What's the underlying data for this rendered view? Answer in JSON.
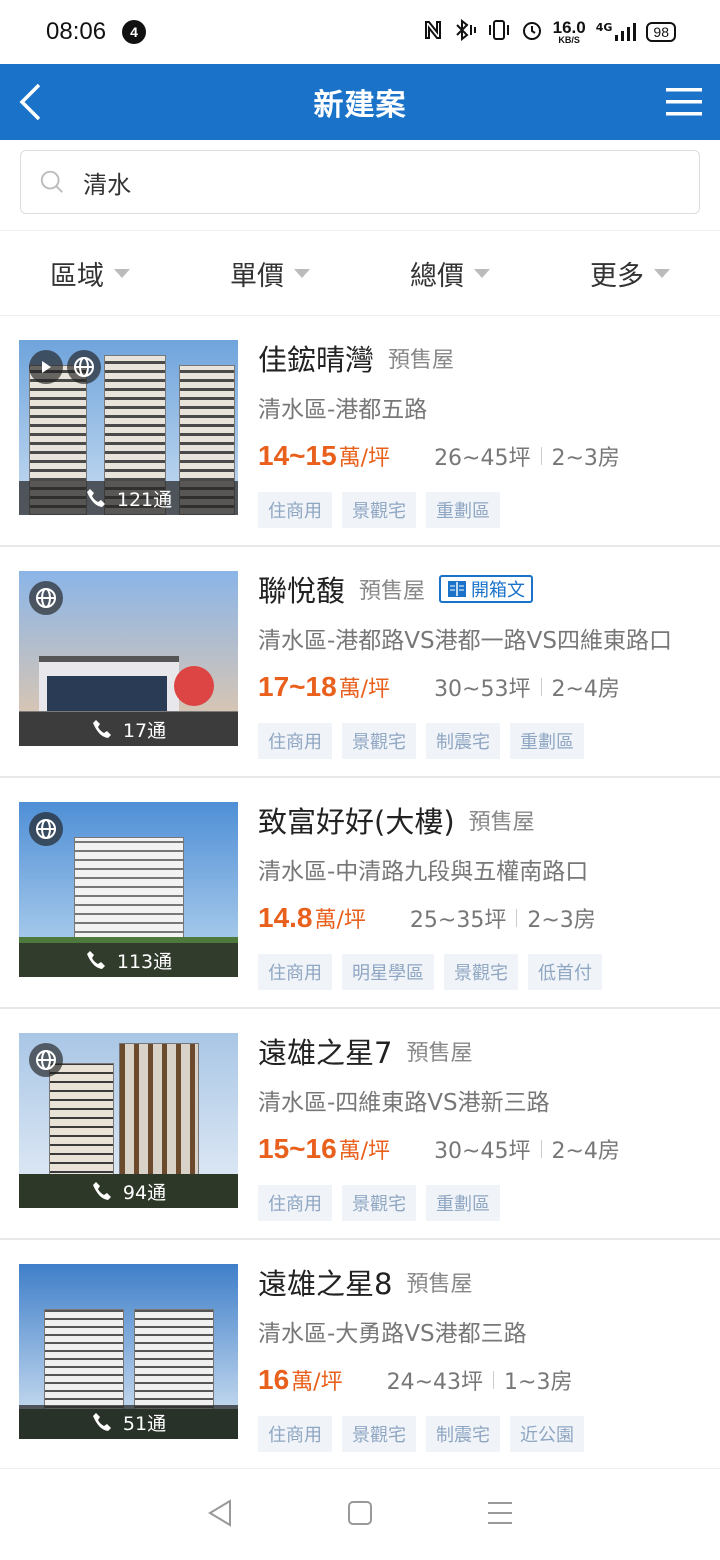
{
  "status": {
    "time": "08:06",
    "notif_count": "4",
    "speed_value": "16.0",
    "speed_unit": "KB/S",
    "network": "4G",
    "battery": "98"
  },
  "header": {
    "title": "新建案"
  },
  "search": {
    "value": "清水",
    "placeholder": ""
  },
  "filters": [
    {
      "label": "區域"
    },
    {
      "label": "單價"
    },
    {
      "label": "總價"
    },
    {
      "label": "更多"
    }
  ],
  "listings": [
    {
      "title": "佳鋐晴灣",
      "type": "預售屋",
      "address": "清水區-港都五路",
      "price": "14~15",
      "unit": "萬/坪",
      "size": "26~45坪",
      "rooms": "2~3房",
      "calls": "121通",
      "tags": [
        "住商用",
        "景觀宅",
        "重劃區"
      ]
    },
    {
      "title": "聯悅馥",
      "type": "預售屋",
      "badge": "開箱文",
      "address": "清水區-港都路VS港都一路VS四維東路口",
      "price": "17~18",
      "unit": "萬/坪",
      "size": "30~53坪",
      "rooms": "2~4房",
      "calls": "17通",
      "tags": [
        "住商用",
        "景觀宅",
        "制震宅",
        "重劃區"
      ]
    },
    {
      "title": "致富好好(大樓)",
      "type": "預售屋",
      "address": "清水區-中清路九段與五權南路口",
      "price": "14.8",
      "unit": "萬/坪",
      "size": "25~35坪",
      "rooms": "2~3房",
      "calls": "113通",
      "tags": [
        "住商用",
        "明星學區",
        "景觀宅",
        "低首付"
      ]
    },
    {
      "title": "遠雄之星7",
      "type": "預售屋",
      "address": "清水區-四維東路VS港新三路",
      "price": "15~16",
      "unit": "萬/坪",
      "size": "30~45坪",
      "rooms": "2~4房",
      "calls": "94通",
      "tags": [
        "住商用",
        "景觀宅",
        "重劃區"
      ]
    },
    {
      "title": "遠雄之星8",
      "type": "預售屋",
      "address": "清水區-大勇路VS港都三路",
      "price": "16",
      "unit": "萬/坪",
      "size": "24~43坪",
      "rooms": "1~3房",
      "calls": "51通",
      "tags": [
        "住商用",
        "景觀宅",
        "制震宅",
        "近公園"
      ]
    }
  ],
  "colors": {
    "header": "#1a73c9",
    "price": "#e8601c",
    "tag_bg": "#f0f4f9",
    "tag_text": "#8fa6c2"
  }
}
